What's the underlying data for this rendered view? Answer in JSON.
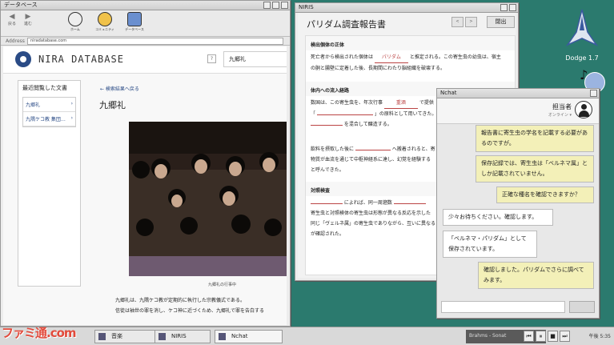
{
  "database_window": {
    "title": "データベース",
    "nav": {
      "back": "戻る",
      "forward": "進む"
    },
    "toolbar_icons": [
      {
        "label": "ホーム",
        "icon": "emblem-icon"
      },
      {
        "label": "コミュニティ",
        "icon": "community-icon"
      },
      {
        "label": "データベース",
        "icon": "database-icon"
      }
    ],
    "address_label": "Address",
    "address_value": "niradatabase.com",
    "brand_name": "NIRA DATABASE",
    "help_label": "?",
    "search_value": "九郷礼",
    "recent_heading": "最近閲覧した文書",
    "recent_items": [
      "九郷礼",
      "九隅ケコ教 集団…"
    ],
    "back_link": "← 検索結果へ戻る",
    "article_title": "九郷礼",
    "photo_caption": "九郷礼の行事中",
    "article_lines": [
      "九郷礼は、九隅ケコ教が定期的に執行した宗教儀式である。",
      "信徒は袖世の罪を消し、ケコ神に近づくため、九郷礼で罪を告白する"
    ]
  },
  "report_window": {
    "title": "NIRIS",
    "heading": "パリダム調査報告書",
    "nav_prev": "<",
    "nav_next": ">",
    "exit_label": "閉出",
    "sections": [
      {
        "heading": "検出個体の正体",
        "lines": [
          {
            "pre": "死亡者から検出された個体は",
            "blank": "パリダム",
            "post": "と推定される。この寄生虫の幼虫は、宿主"
          },
          {
            "pre": "の胴と腸壁に定着した後、長期間にわたり脳組織を破壊する。",
            "blank": "",
            "post": ""
          }
        ]
      },
      {
        "heading": "体内への流入経路",
        "lines": [
          {
            "pre": "数国は、この寄生虫を、年次行事",
            "blank": "重酒",
            "post": "で提供"
          },
          {
            "pre": "「",
            "blank": "",
            "post": "」の原料として用いてきた。この飲料は"
          },
          {
            "pre": "",
            "blank": "",
            "post": "を混合して醸造する。"
          }
        ]
      },
      {
        "heading": "",
        "lines": [
          {
            "pre": "飲料を摂取した後に",
            "blank": "",
            "post": "へ搬着されると、寄"
          },
          {
            "pre": "物質が血流を通じて中枢神経系に達し、幻覚を経験する",
            "blank": "",
            "post": ""
          },
          {
            "pre": "と呼んできた。",
            "blank": "",
            "post": ""
          }
        ]
      },
      {
        "heading": "対照検査",
        "lines": [
          {
            "pre": "",
            "blank": "",
            "post": "によれば、同一周遡数"
          },
          {
            "pre": "寄生虫と対照検体の寄生虫は形態が異なる反応を示した",
            "blank": "",
            "post": ""
          },
          {
            "pre": "同じ「ヴェルネ属」の寄生虫でありながら、互いに異なる",
            "blank": "",
            "post": ""
          },
          {
            "pre": "が確認された。",
            "blank": "",
            "post": ""
          }
        ]
      }
    ]
  },
  "chat_window": {
    "title": "Nchat",
    "contact_name": "担当者",
    "contact_status": "オンライン ▾",
    "messages": [
      {
        "side": "me",
        "text": "報告書に寄生虫の学名を記載する必要があるのですが。"
      },
      {
        "side": "me",
        "text": "保存記録では、寄生虫は「ベルネマ属」としか記載されていません。"
      },
      {
        "side": "me",
        "text": "正確な種名を確認できますか？"
      },
      {
        "side": "them",
        "text": "少々お待ちください。確認します。"
      },
      {
        "side": "them",
        "text": "「ベルネマ・パリダム」として保存されています。"
      },
      {
        "side": "me",
        "text": "確認しました。パリダムでさらに調べてみます。"
      }
    ]
  },
  "desktop": {
    "icons": [
      {
        "label": "Dodge 1.7",
        "icon": "spaceship-icon"
      }
    ]
  },
  "taskbar": {
    "tasks": [
      {
        "label": "音楽",
        "icon": "music-icon"
      },
      {
        "label": "NIRIS",
        "icon": "niris-icon"
      },
      {
        "label": "Nchat",
        "icon": "chat-icon"
      }
    ],
    "now_playing": "Brahms - Sonat",
    "media_buttons": [
      "prev-icon",
      "pause-icon",
      "stop-icon",
      "next-icon"
    ],
    "clock": "午後 5:35"
  },
  "watermark": "ファミ通.com"
}
